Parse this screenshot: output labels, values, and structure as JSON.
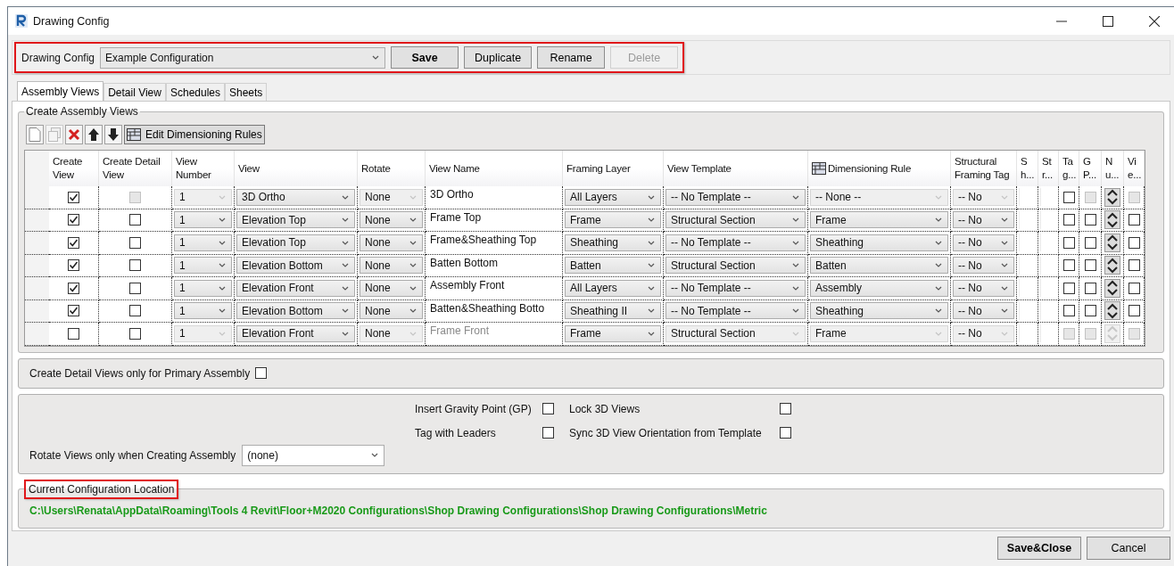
{
  "window": {
    "title": "Drawing Config"
  },
  "config_bar": {
    "label": "Drawing Config",
    "selected_config": "Example Configuration",
    "buttons": [
      {
        "label": "Save",
        "bold": true,
        "disabled": false
      },
      {
        "label": "Duplicate",
        "bold": false,
        "disabled": false
      },
      {
        "label": "Rename",
        "bold": false,
        "disabled": false
      },
      {
        "label": "Delete",
        "bold": false,
        "disabled": true
      }
    ]
  },
  "tabs": [
    {
      "label": "Assembly Views",
      "selected": true
    },
    {
      "label": "Detail View",
      "selected": false
    },
    {
      "label": "Schedules",
      "selected": false
    },
    {
      "label": "Sheets",
      "selected": false
    }
  ],
  "create_views": {
    "title": "Create Assembly Views",
    "toolbar": [
      {
        "kind": "new",
        "disabled": false
      },
      {
        "kind": "copy",
        "disabled": true
      },
      {
        "kind": "delete",
        "disabled": false
      },
      {
        "kind": "up",
        "disabled": false
      },
      {
        "kind": "down",
        "disabled": false
      },
      {
        "kind": "rules",
        "label": "Edit Dimensioning Rules",
        "disabled": false
      }
    ],
    "table": {
      "columns": [
        {
          "label": "Create View",
          "icon": false
        },
        {
          "label": "Create Detail View",
          "icon": false
        },
        {
          "label": "View Number",
          "icon": false
        },
        {
          "label": "View",
          "icon": false
        },
        {
          "label": "Rotate",
          "icon": false
        },
        {
          "label": "View Name",
          "icon": false
        },
        {
          "label": "Framing Layer",
          "icon": false
        },
        {
          "label": "View Template",
          "icon": false
        },
        {
          "label": "Dimensioning Rule",
          "icon": true
        },
        {
          "label": "Structural Framing Tag",
          "icon": false
        },
        {
          "label": "S h...",
          "icon": false
        },
        {
          "label": "St r...",
          "icon": false
        },
        {
          "label": "Ta g...",
          "icon": false
        },
        {
          "label": "G P...",
          "icon": false
        },
        {
          "label": "N u...",
          "icon": false
        },
        {
          "label": "Vi e...",
          "icon": false
        }
      ],
      "rows": [
        {
          "cells": [
            {
              "kind": "check",
              "checked": true,
              "disabled": false
            },
            {
              "kind": "check",
              "checked": false,
              "disabled": true
            },
            {
              "kind": "combo",
              "value": "1",
              "disabled": true
            },
            {
              "kind": "combo",
              "value": "3D Ortho",
              "disabled": false
            },
            {
              "kind": "combo",
              "value": "None",
              "disabled": true
            },
            {
              "kind": "text",
              "value": "3D Ortho",
              "disabled": false
            },
            {
              "kind": "combo",
              "value": "All Layers",
              "disabled": false
            },
            {
              "kind": "combo",
              "value": "-- No Template --",
              "disabled": false
            },
            {
              "kind": "combo",
              "value": "-- None --",
              "disabled": true
            },
            {
              "kind": "combo",
              "value": "-- No",
              "disabled": true
            },
            {
              "kind": "blank"
            },
            {
              "kind": "blank"
            },
            {
              "kind": "check",
              "checked": false,
              "disabled": false
            },
            {
              "kind": "check",
              "checked": false,
              "disabled": true
            },
            {
              "kind": "spin",
              "disabled": false
            },
            {
              "kind": "check",
              "checked": false,
              "disabled": true
            }
          ]
        },
        {
          "cells": [
            {
              "kind": "check",
              "checked": true,
              "disabled": false
            },
            {
              "kind": "check",
              "checked": false,
              "disabled": false
            },
            {
              "kind": "combo",
              "value": "1",
              "disabled": false
            },
            {
              "kind": "combo",
              "value": "Elevation Top",
              "disabled": false
            },
            {
              "kind": "combo",
              "value": "None",
              "disabled": false
            },
            {
              "kind": "text",
              "value": "Frame Top",
              "disabled": false
            },
            {
              "kind": "combo",
              "value": "Frame",
              "disabled": false
            },
            {
              "kind": "combo",
              "value": "Structural Section",
              "disabled": false
            },
            {
              "kind": "combo",
              "value": "Frame",
              "disabled": false
            },
            {
              "kind": "combo",
              "value": "-- No",
              "disabled": false
            },
            {
              "kind": "blank"
            },
            {
              "kind": "blank"
            },
            {
              "kind": "check",
              "checked": false,
              "disabled": false
            },
            {
              "kind": "check",
              "checked": false,
              "disabled": false
            },
            {
              "kind": "spin",
              "disabled": false
            },
            {
              "kind": "check",
              "checked": false,
              "disabled": false
            }
          ]
        },
        {
          "cells": [
            {
              "kind": "check",
              "checked": true,
              "disabled": false
            },
            {
              "kind": "check",
              "checked": false,
              "disabled": false
            },
            {
              "kind": "combo",
              "value": "1",
              "disabled": false
            },
            {
              "kind": "combo",
              "value": "Elevation Top",
              "disabled": false
            },
            {
              "kind": "combo",
              "value": "None",
              "disabled": false
            },
            {
              "kind": "text",
              "value": "Frame&Sheathing Top",
              "disabled": false
            },
            {
              "kind": "combo",
              "value": "Sheathing",
              "disabled": false
            },
            {
              "kind": "combo",
              "value": "-- No Template --",
              "disabled": false
            },
            {
              "kind": "combo",
              "value": "Sheathing",
              "disabled": false
            },
            {
              "kind": "combo",
              "value": "-- No",
              "disabled": false
            },
            {
              "kind": "blank"
            },
            {
              "kind": "blank"
            },
            {
              "kind": "check",
              "checked": false,
              "disabled": false
            },
            {
              "kind": "check",
              "checked": false,
              "disabled": false
            },
            {
              "kind": "spin",
              "disabled": false
            },
            {
              "kind": "check",
              "checked": false,
              "disabled": false
            }
          ]
        },
        {
          "cells": [
            {
              "kind": "check",
              "checked": true,
              "disabled": false
            },
            {
              "kind": "check",
              "checked": false,
              "disabled": false
            },
            {
              "kind": "combo",
              "value": "1",
              "disabled": false
            },
            {
              "kind": "combo",
              "value": "Elevation Bottom",
              "disabled": false
            },
            {
              "kind": "combo",
              "value": "None",
              "disabled": false
            },
            {
              "kind": "text",
              "value": "Batten Bottom",
              "disabled": false
            },
            {
              "kind": "combo",
              "value": "Batten",
              "disabled": false
            },
            {
              "kind": "combo",
              "value": "Structural Section",
              "disabled": false
            },
            {
              "kind": "combo",
              "value": "Batten",
              "disabled": false
            },
            {
              "kind": "combo",
              "value": "-- No",
              "disabled": false
            },
            {
              "kind": "blank"
            },
            {
              "kind": "blank"
            },
            {
              "kind": "check",
              "checked": false,
              "disabled": false
            },
            {
              "kind": "check",
              "checked": false,
              "disabled": false
            },
            {
              "kind": "spin",
              "disabled": false
            },
            {
              "kind": "check",
              "checked": false,
              "disabled": false
            }
          ]
        },
        {
          "cells": [
            {
              "kind": "check",
              "checked": true,
              "disabled": false
            },
            {
              "kind": "check",
              "checked": false,
              "disabled": false
            },
            {
              "kind": "combo",
              "value": "1",
              "disabled": false
            },
            {
              "kind": "combo",
              "value": "Elevation Front",
              "disabled": false
            },
            {
              "kind": "combo",
              "value": "None",
              "disabled": false
            },
            {
              "kind": "text",
              "value": "Assembly Front",
              "disabled": false
            },
            {
              "kind": "combo",
              "value": "All Layers",
              "disabled": false
            },
            {
              "kind": "combo",
              "value": "-- No Template --",
              "disabled": false
            },
            {
              "kind": "combo",
              "value": "Assembly",
              "disabled": false
            },
            {
              "kind": "combo",
              "value": "-- No",
              "disabled": false
            },
            {
              "kind": "blank"
            },
            {
              "kind": "blank"
            },
            {
              "kind": "check",
              "checked": false,
              "disabled": false
            },
            {
              "kind": "check",
              "checked": false,
              "disabled": false
            },
            {
              "kind": "spin",
              "disabled": false
            },
            {
              "kind": "check",
              "checked": false,
              "disabled": false
            }
          ]
        },
        {
          "cells": [
            {
              "kind": "check",
              "checked": true,
              "disabled": false
            },
            {
              "kind": "check",
              "checked": false,
              "disabled": false
            },
            {
              "kind": "combo",
              "value": "1",
              "disabled": false
            },
            {
              "kind": "combo",
              "value": "Elevation Bottom",
              "disabled": false
            },
            {
              "kind": "combo",
              "value": "None",
              "disabled": false
            },
            {
              "kind": "text",
              "value": "Batten&Sheathing Botto",
              "disabled": false
            },
            {
              "kind": "combo",
              "value": "Sheathing II",
              "disabled": false
            },
            {
              "kind": "combo",
              "value": "-- No Template --",
              "disabled": false
            },
            {
              "kind": "combo",
              "value": "Sheathing",
              "disabled": false
            },
            {
              "kind": "combo",
              "value": "-- No",
              "disabled": false
            },
            {
              "kind": "blank"
            },
            {
              "kind": "blank"
            },
            {
              "kind": "check",
              "checked": false,
              "disabled": false
            },
            {
              "kind": "check",
              "checked": false,
              "disabled": false
            },
            {
              "kind": "spin",
              "disabled": false
            },
            {
              "kind": "check",
              "checked": false,
              "disabled": false
            }
          ]
        },
        {
          "cells": [
            {
              "kind": "check",
              "checked": false,
              "disabled": false
            },
            {
              "kind": "check",
              "checked": false,
              "disabled": false
            },
            {
              "kind": "combo",
              "value": "1",
              "disabled": true
            },
            {
              "kind": "combo",
              "value": "Elevation Front",
              "disabled": false
            },
            {
              "kind": "combo",
              "value": "None",
              "disabled": true
            },
            {
              "kind": "text",
              "value": "Frame Front",
              "disabled": true
            },
            {
              "kind": "combo",
              "value": "Frame",
              "disabled": false
            },
            {
              "kind": "combo",
              "value": "Structural Section",
              "disabled": true
            },
            {
              "kind": "combo",
              "value": "Frame",
              "disabled": true
            },
            {
              "kind": "combo",
              "value": "-- No",
              "disabled": true
            },
            {
              "kind": "blank"
            },
            {
              "kind": "blank"
            },
            {
              "kind": "check",
              "checked": false,
              "disabled": true
            },
            {
              "kind": "check",
              "checked": false,
              "disabled": true
            },
            {
              "kind": "spin",
              "disabled": true
            },
            {
              "kind": "check",
              "checked": false,
              "disabled": true
            }
          ]
        }
      ]
    }
  },
  "primary_only": {
    "label": "Create Detail Views only for Primary Assembly",
    "checked": false
  },
  "options": [
    {
      "label": "Insert Gravity Point (GP)",
      "checked": false
    },
    {
      "label": "Lock 3D Views",
      "checked": false
    },
    {
      "label": "Tag with Leaders",
      "checked": false
    },
    {
      "label": "Sync 3D View Orientation from Template",
      "checked": false
    }
  ],
  "rotate_views": {
    "label": "Rotate Views only when Creating Assembly",
    "value": "(none)"
  },
  "location": {
    "title": "Current Configuration Location",
    "path": "C:\\Users\\Renata\\AppData\\Roaming\\Tools 4 Revit\\Floor+M2020 Configurations\\Shop Drawing Configurations\\Shop Drawing Configurations\\Metric"
  },
  "footer_buttons": [
    {
      "label": "Save&Close",
      "bold": true
    },
    {
      "label": "Cancel",
      "bold": false
    }
  ]
}
